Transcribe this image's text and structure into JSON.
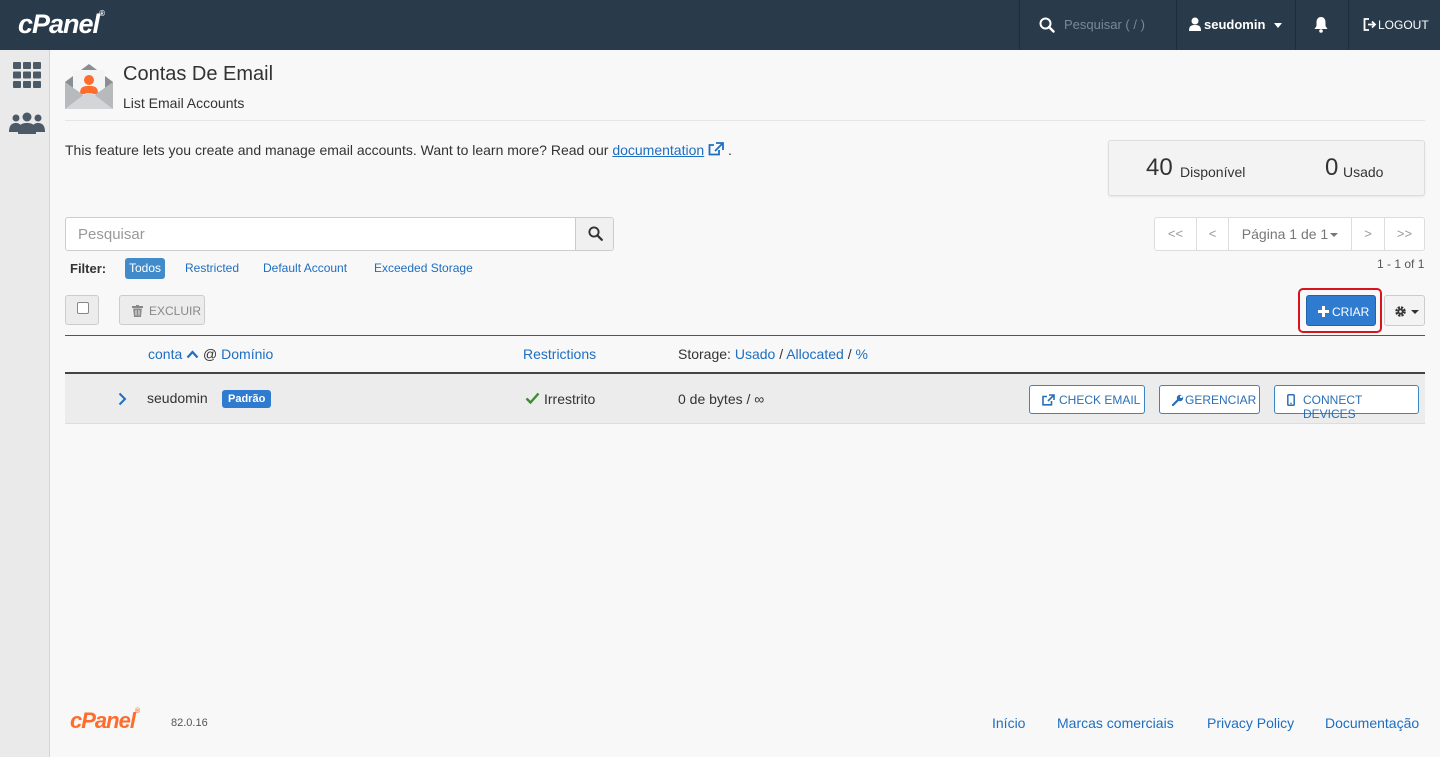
{
  "topbar": {
    "brand": "cPanel",
    "search_placeholder": "Pesquisar ( / )",
    "username": "seudomin",
    "logout": "LOGOUT"
  },
  "header": {
    "title": "Contas De Email",
    "subtitle": "List Email Accounts"
  },
  "description": {
    "text": "This feature lets you create and manage email accounts. Want to learn more? Read our ",
    "link": "documentation",
    "suffix": "."
  },
  "stats": {
    "available_count": "40",
    "available_label": "Disponível",
    "used_count": "0",
    "used_label": "Usado"
  },
  "search": {
    "placeholder": "Pesquisar"
  },
  "filters": {
    "label": "Filter:",
    "items": [
      "Todos",
      "Restricted",
      "Default Account",
      "Exceeded Storage"
    ],
    "active": "Todos"
  },
  "pagination": {
    "first": "<<",
    "prev": "<",
    "page": "Página 1 de 1",
    "next": ">",
    "last": ">>",
    "count": "1 - 1 of 1"
  },
  "toolbar": {
    "delete": "EXCLUIR",
    "create": "CRIAR"
  },
  "table": {
    "col_account": "conta",
    "col_at": "@",
    "col_domain": "Domínio",
    "col_restrictions": "Restrictions",
    "col_storage_label": "Storage:",
    "col_storage_used": "Usado",
    "col_storage_allocated": "Allocated",
    "col_storage_pct": "%",
    "sep": "/",
    "rows": [
      {
        "account": "seudomin",
        "badge": "Padrão",
        "restriction": "Irrestrito",
        "storage": "0 de bytes / ∞",
        "actions": [
          "CHECK EMAIL",
          "GERENCIAR",
          "CONNECT DEVICES"
        ]
      }
    ]
  },
  "footer": {
    "brand": "cPanel",
    "version": "82.0.16",
    "links": [
      "Início",
      "Marcas comerciais",
      "Privacy Policy",
      "Documentação"
    ]
  },
  "colors": {
    "topbar": "#293a4a",
    "primary": "#2f7bd0",
    "link": "#1e6ec2",
    "highlight": "#d9131e",
    "footer_brand": "#ff6c2c"
  }
}
